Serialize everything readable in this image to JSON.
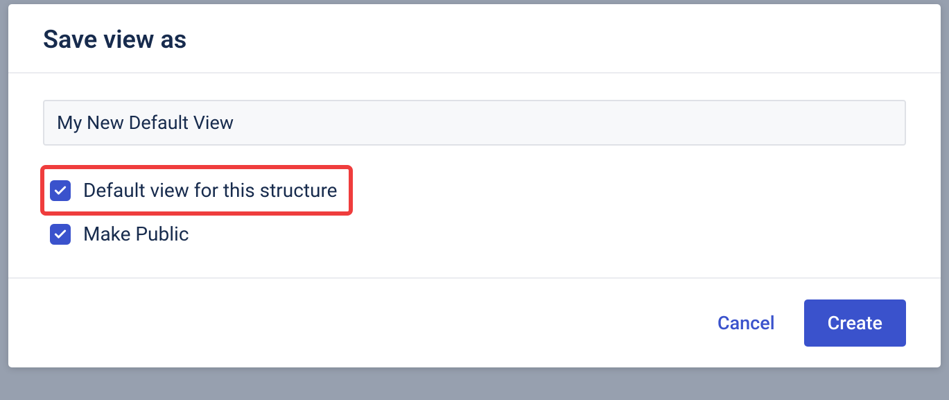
{
  "dialog": {
    "title": "Save view as",
    "name_input": {
      "value": "My New Default View"
    },
    "options": {
      "default_view": {
        "label": "Default view for this structure",
        "checked": true
      },
      "make_public": {
        "label": "Make Public",
        "checked": true
      }
    },
    "buttons": {
      "cancel": "Cancel",
      "create": "Create"
    }
  }
}
